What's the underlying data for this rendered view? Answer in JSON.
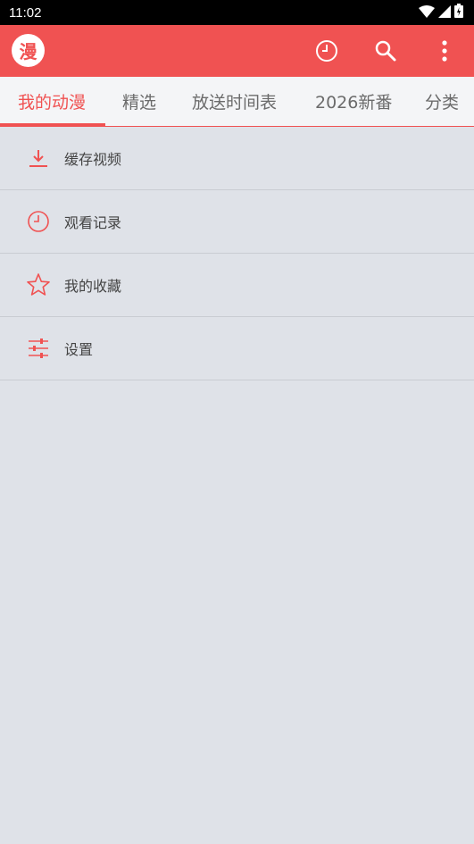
{
  "status_bar": {
    "time": "11:02"
  },
  "app_bar": {
    "logo_text": "漫",
    "accent_color": "#f05252",
    "actions": [
      "history-icon",
      "search-icon",
      "more-vert-icon"
    ]
  },
  "tabs": [
    {
      "label": "我的动漫",
      "active": true
    },
    {
      "label": "精选",
      "active": false
    },
    {
      "label": "放送时间表",
      "active": false
    },
    {
      "label": "2026新番",
      "active": false
    },
    {
      "label": "分类",
      "active": false
    }
  ],
  "menu": {
    "items": [
      {
        "label": "缓存视频",
        "icon": "download-icon"
      },
      {
        "label": "观看记录",
        "icon": "clock-icon"
      },
      {
        "label": "我的收藏",
        "icon": "star-icon"
      },
      {
        "label": "设置",
        "icon": "sliders-icon"
      }
    ]
  }
}
